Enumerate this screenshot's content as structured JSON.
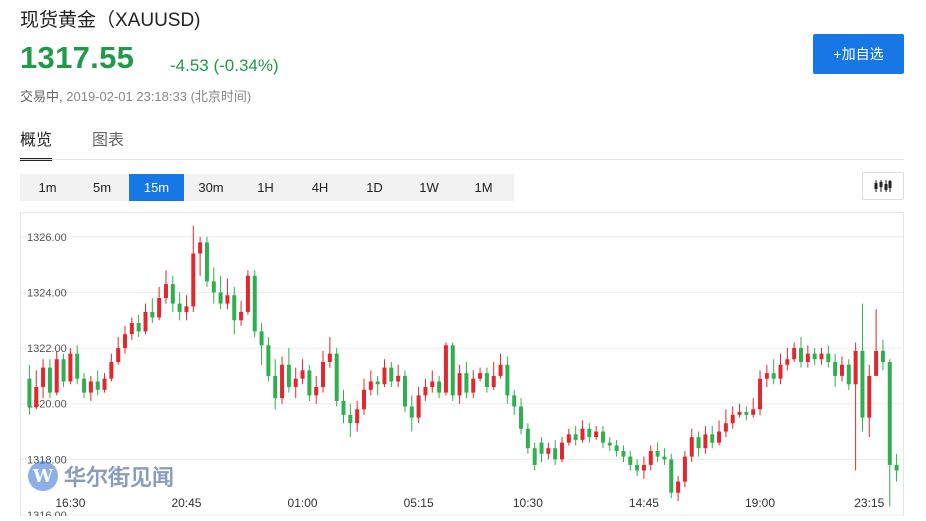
{
  "header": {
    "title": "现货黄金（XAUUSD)",
    "price": "1317.55",
    "change": "-4.53 (-0.34%)",
    "status_label": "交易中,",
    "timestamp": "2019-02-01 23:18:33 (北京时间)",
    "add_button": "+加自选"
  },
  "tabs": [
    {
      "label": "概览",
      "active": true
    },
    {
      "label": "图表",
      "active": false
    }
  ],
  "periods": [
    {
      "label": "1m",
      "active": false
    },
    {
      "label": "5m",
      "active": false
    },
    {
      "label": "15m",
      "active": true
    },
    {
      "label": "30m",
      "active": false
    },
    {
      "label": "1H",
      "active": false
    },
    {
      "label": "4H",
      "active": false
    },
    {
      "label": "1D",
      "active": false
    },
    {
      "label": "1W",
      "active": false
    },
    {
      "label": "1M",
      "active": false
    }
  ],
  "watermark": {
    "logo": "W",
    "text": "华尔街见闻"
  },
  "colors": {
    "up": "#e0282e",
    "down": "#2eb04e",
    "accent": "#1677e5",
    "price": "#1e9a4a"
  },
  "chart_data": {
    "type": "candlestick",
    "ylim": [
      1316,
      1327
    ],
    "y_ticks": [
      "1326.00",
      "1324.00",
      "1322.00",
      "1320.00",
      "1318.00",
      "1316.00"
    ],
    "y_tick_values": [
      1326,
      1324,
      1322,
      1320,
      1318,
      1316
    ],
    "x_ticks": [
      "16:30",
      "20:45",
      "01:00",
      "05:15",
      "10:30",
      "14:45",
      "19:00",
      "23:15"
    ],
    "x_tick_index": [
      6,
      23,
      40,
      57,
      73,
      90,
      107,
      123
    ],
    "candles": [
      [
        1320.9,
        1319.9,
        1321.4,
        1319.6
      ],
      [
        1319.9,
        1320.6,
        1321.2,
        1319.8
      ],
      [
        1320.6,
        1321.3,
        1321.6,
        1320.2
      ],
      [
        1321.3,
        1320.4,
        1321.6,
        1320.2
      ],
      [
        1320.4,
        1321.6,
        1321.9,
        1320.3
      ],
      [
        1321.6,
        1320.8,
        1321.8,
        1320.6
      ],
      [
        1320.8,
        1321.8,
        1322.0,
        1320.7
      ],
      [
        1321.8,
        1320.9,
        1322.1,
        1320.7
      ],
      [
        1320.9,
        1320.4,
        1321.1,
        1320.2
      ],
      [
        1320.4,
        1320.8,
        1321.0,
        1320.1
      ],
      [
        1320.8,
        1320.5,
        1321.2,
        1320.3
      ],
      [
        1320.5,
        1320.9,
        1321.1,
        1320.4
      ],
      [
        1320.9,
        1321.5,
        1321.8,
        1320.8
      ],
      [
        1321.5,
        1322.0,
        1322.4,
        1321.4
      ],
      [
        1322.0,
        1322.5,
        1322.8,
        1321.8
      ],
      [
        1322.5,
        1322.9,
        1323.1,
        1322.3
      ],
      [
        1322.9,
        1322.6,
        1323.2,
        1322.4
      ],
      [
        1322.6,
        1323.3,
        1323.6,
        1322.5
      ],
      [
        1323.3,
        1323.1,
        1323.8,
        1322.9
      ],
      [
        1323.1,
        1323.8,
        1324.2,
        1323.0
      ],
      [
        1323.8,
        1324.3,
        1324.8,
        1323.6
      ],
      [
        1324.3,
        1323.6,
        1324.6,
        1323.3
      ],
      [
        1323.6,
        1323.3,
        1324.0,
        1323.0
      ],
      [
        1323.3,
        1323.5,
        1323.9,
        1323.0
      ],
      [
        1323.5,
        1325.4,
        1326.4,
        1323.3
      ],
      [
        1325.4,
        1325.8,
        1326.0,
        1324.6
      ],
      [
        1325.8,
        1324.4,
        1326.0,
        1324.2
      ],
      [
        1324.4,
        1324.0,
        1324.9,
        1323.6
      ],
      [
        1324.0,
        1323.6,
        1324.6,
        1323.4
      ],
      [
        1323.6,
        1323.9,
        1324.5,
        1323.4
      ],
      [
        1323.9,
        1323.0,
        1324.2,
        1322.5
      ],
      [
        1323.0,
        1323.3,
        1323.7,
        1322.8
      ],
      [
        1323.3,
        1324.6,
        1324.8,
        1323.2
      ],
      [
        1324.6,
        1322.6,
        1324.8,
        1322.4
      ],
      [
        1322.6,
        1322.1,
        1322.9,
        1321.4
      ],
      [
        1322.1,
        1321.0,
        1322.4,
        1320.8
      ],
      [
        1321.0,
        1320.2,
        1321.6,
        1319.8
      ],
      [
        1320.2,
        1321.4,
        1321.7,
        1320.0
      ],
      [
        1321.4,
        1320.6,
        1322.0,
        1320.4
      ],
      [
        1320.6,
        1320.9,
        1321.3,
        1320.2
      ],
      [
        1320.9,
        1321.2,
        1321.6,
        1320.7
      ],
      [
        1321.2,
        1320.3,
        1321.4,
        1320.1
      ],
      [
        1320.3,
        1320.6,
        1321.0,
        1320.0
      ],
      [
        1320.6,
        1321.5,
        1321.9,
        1320.4
      ],
      [
        1321.5,
        1321.8,
        1322.4,
        1321.3
      ],
      [
        1321.8,
        1320.1,
        1322.0,
        1319.9
      ],
      [
        1320.1,
        1319.6,
        1320.5,
        1319.3
      ],
      [
        1319.6,
        1319.3,
        1320.0,
        1318.8
      ],
      [
        1319.3,
        1319.8,
        1320.1,
        1319.0
      ],
      [
        1319.8,
        1320.5,
        1320.9,
        1319.6
      ],
      [
        1320.5,
        1320.8,
        1321.2,
        1320.3
      ],
      [
        1320.8,
        1320.7,
        1321.0,
        1320.3
      ],
      [
        1320.7,
        1321.3,
        1321.6,
        1320.6
      ],
      [
        1321.3,
        1320.8,
        1321.5,
        1320.6
      ],
      [
        1320.8,
        1321.0,
        1321.4,
        1320.6
      ],
      [
        1321.0,
        1319.9,
        1321.2,
        1319.7
      ],
      [
        1319.9,
        1319.5,
        1320.3,
        1319.0
      ],
      [
        1319.5,
        1320.3,
        1320.6,
        1319.3
      ],
      [
        1320.3,
        1320.6,
        1320.9,
        1320.1
      ],
      [
        1320.6,
        1320.8,
        1321.2,
        1320.4
      ],
      [
        1320.8,
        1320.4,
        1321.0,
        1320.2
      ],
      [
        1320.4,
        1322.1,
        1322.2,
        1320.3
      ],
      [
        1322.1,
        1320.3,
        1322.2,
        1320.1
      ],
      [
        1320.3,
        1321.1,
        1321.4,
        1320.0
      ],
      [
        1321.1,
        1320.4,
        1321.5,
        1320.2
      ],
      [
        1320.4,
        1320.9,
        1321.2,
        1320.2
      ],
      [
        1320.9,
        1321.1,
        1321.3,
        1320.8
      ],
      [
        1321.1,
        1320.6,
        1321.3,
        1320.4
      ],
      [
        1320.6,
        1321.0,
        1321.5,
        1320.5
      ],
      [
        1321.0,
        1321.4,
        1321.8,
        1320.9
      ],
      [
        1321.4,
        1320.3,
        1321.7,
        1320.0
      ],
      [
        1320.3,
        1319.9,
        1320.5,
        1319.6
      ],
      [
        1319.9,
        1319.1,
        1320.2,
        1318.9
      ],
      [
        1319.1,
        1318.4,
        1319.3,
        1318.2
      ],
      [
        1318.4,
        1317.8,
        1318.6,
        1317.6
      ],
      [
        1318.6,
        1318.2,
        1318.8,
        1317.9
      ],
      [
        1318.2,
        1318.4,
        1318.6,
        1318.0
      ],
      [
        1318.4,
        1318.0,
        1318.7,
        1317.8
      ],
      [
        1318.0,
        1318.6,
        1318.8,
        1317.9
      ],
      [
        1318.6,
        1318.9,
        1319.1,
        1318.5
      ],
      [
        1318.9,
        1318.7,
        1319.2,
        1318.5
      ],
      [
        1318.7,
        1319.1,
        1319.4,
        1318.6
      ],
      [
        1319.1,
        1318.8,
        1319.3,
        1318.6
      ],
      [
        1318.8,
        1319.0,
        1319.2,
        1318.7
      ],
      [
        1319.0,
        1318.6,
        1319.2,
        1318.4
      ],
      [
        1318.6,
        1318.5,
        1318.8,
        1318.3
      ],
      [
        1318.5,
        1318.3,
        1318.7,
        1318.1
      ],
      [
        1318.3,
        1318.1,
        1318.5,
        1317.9
      ],
      [
        1318.1,
        1317.8,
        1318.3,
        1317.6
      ],
      [
        1317.8,
        1317.6,
        1318.0,
        1317.4
      ],
      [
        1317.6,
        1317.8,
        1318.1,
        1317.3
      ],
      [
        1317.8,
        1318.3,
        1318.5,
        1317.6
      ],
      [
        1318.3,
        1318.1,
        1318.6,
        1317.9
      ],
      [
        1318.1,
        1318.0,
        1318.4,
        1317.8
      ],
      [
        1318.0,
        1316.8,
        1318.2,
        1316.6
      ],
      [
        1316.8,
        1317.2,
        1317.4,
        1316.5
      ],
      [
        1317.2,
        1318.1,
        1318.3,
        1317.0
      ],
      [
        1318.1,
        1318.8,
        1319.1,
        1317.9
      ],
      [
        1318.8,
        1318.4,
        1319.0,
        1318.1
      ],
      [
        1318.4,
        1318.9,
        1319.2,
        1318.2
      ],
      [
        1318.9,
        1318.6,
        1319.2,
        1318.4
      ],
      [
        1318.6,
        1319.0,
        1319.4,
        1318.5
      ],
      [
        1319.0,
        1319.3,
        1319.8,
        1318.8
      ],
      [
        1319.3,
        1319.6,
        1319.9,
        1319.1
      ],
      [
        1319.6,
        1319.7,
        1320.0,
        1319.5
      ],
      [
        1319.7,
        1319.6,
        1319.9,
        1319.4
      ],
      [
        1319.6,
        1319.8,
        1320.2,
        1319.5
      ],
      [
        1319.8,
        1320.9,
        1321.2,
        1319.6
      ],
      [
        1320.9,
        1321.1,
        1321.4,
        1320.6
      ],
      [
        1321.1,
        1320.9,
        1321.6,
        1320.7
      ],
      [
        1320.9,
        1321.4,
        1321.8,
        1320.7
      ],
      [
        1321.4,
        1321.6,
        1322.0,
        1321.2
      ],
      [
        1321.6,
        1322.0,
        1322.2,
        1321.5
      ],
      [
        1322.0,
        1321.5,
        1322.4,
        1321.3
      ],
      [
        1321.5,
        1321.8,
        1322.1,
        1321.3
      ],
      [
        1321.8,
        1321.6,
        1322.0,
        1321.4
      ],
      [
        1321.6,
        1321.8,
        1322.0,
        1321.4
      ],
      [
        1321.8,
        1321.5,
        1322.1,
        1321.3
      ],
      [
        1321.5,
        1321.0,
        1321.8,
        1320.6
      ],
      [
        1321.0,
        1321.4,
        1321.7,
        1320.8
      ],
      [
        1321.4,
        1320.7,
        1321.6,
        1320.5
      ],
      [
        1320.7,
        1321.9,
        1322.2,
        1317.6
      ],
      [
        1321.9,
        1319.5,
        1323.6,
        1319.0
      ],
      [
        1319.5,
        1321.0,
        1321.4,
        1318.8
      ],
      [
        1321.0,
        1321.9,
        1323.4,
        1321.5
      ],
      [
        1321.9,
        1321.5,
        1322.3,
        1321.2
      ],
      [
        1321.5,
        1317.8,
        1321.6,
        1316.3
      ],
      [
        1317.8,
        1317.6,
        1318.2,
        1317.2
      ]
    ]
  }
}
